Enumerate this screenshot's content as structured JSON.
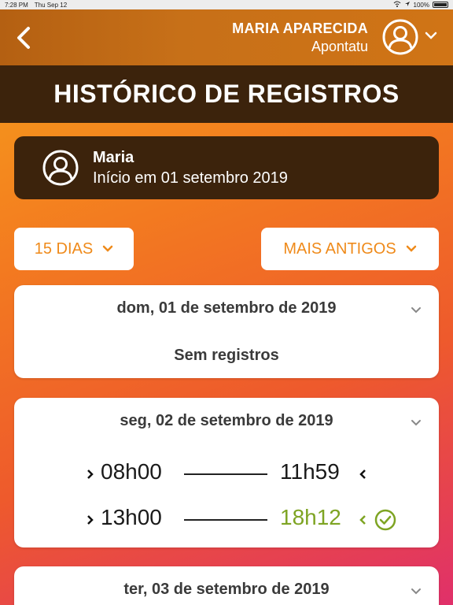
{
  "status": {
    "time": "7:28 PM",
    "date": "Thu Sep 12",
    "battery": "100%"
  },
  "header": {
    "user_name": "MARIA APARECIDA",
    "company": "Apontatu"
  },
  "title": "HISTÓRICO DE REGISTROS",
  "profile": {
    "name": "Maria",
    "since": "Início em 01 setembro 2019"
  },
  "filters": {
    "days": "15 DIAS",
    "order": "MAIS ANTIGOS"
  },
  "days": [
    {
      "date": "dom, 01 de setembro de 2019",
      "empty": "Sem registros"
    },
    {
      "date": "seg, 02 de setembro de 2019",
      "punches": [
        {
          "in": "08h00",
          "out": "11h59"
        },
        {
          "in": "13h00",
          "out": "18h12"
        }
      ]
    },
    {
      "date": "ter, 03 de setembro de 2019"
    }
  ],
  "colors": {
    "accent": "#ef8a1a",
    "dark": "#3c230c",
    "late": "#7ea423"
  }
}
